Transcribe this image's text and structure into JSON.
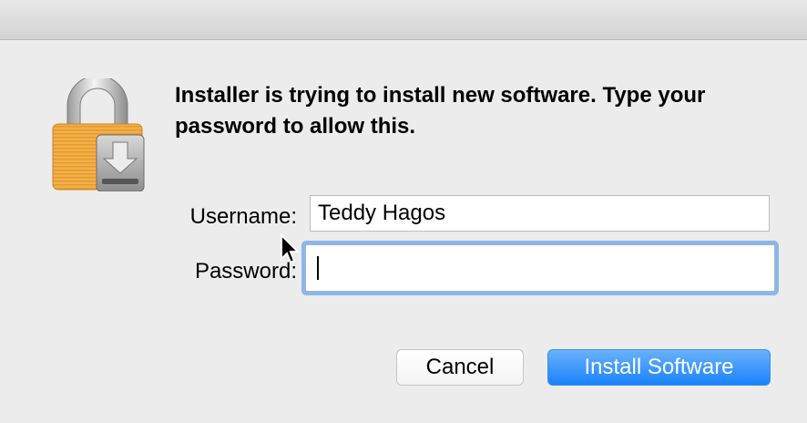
{
  "dialog": {
    "message": "Installer is trying to install new software. Type your password to allow this.",
    "icon": "lock-install-icon"
  },
  "form": {
    "username_label": "Username:",
    "username_value": "Teddy Hagos",
    "password_label": "Password:",
    "password_value": ""
  },
  "buttons": {
    "cancel_label": "Cancel",
    "install_label": "Install Software"
  },
  "colors": {
    "background": "#ececec",
    "accent": "#1a82fb",
    "focus_ring": "#8bb6ea",
    "lock_gold": "#f2a93b"
  }
}
